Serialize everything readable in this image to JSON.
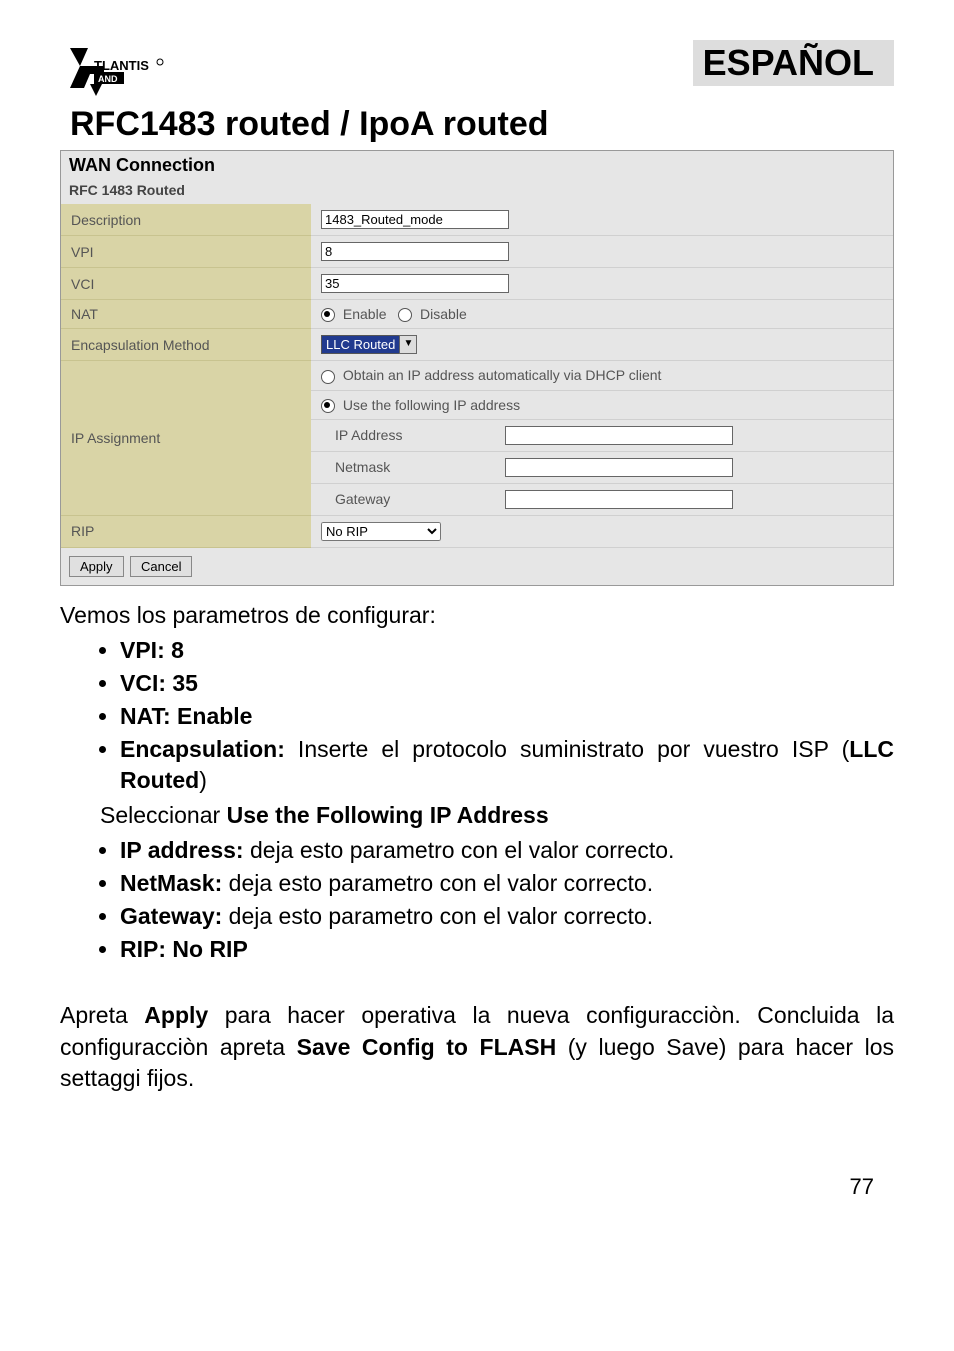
{
  "header": {
    "logo_text_top": "TLANTIS",
    "logo_text_bottom": "AND",
    "language": "ESPAÑOL"
  },
  "title": "RFC1483 routed / IpoA routed",
  "panel": {
    "section": "WAN Connection",
    "subsection": "RFC 1483 Routed",
    "rows": {
      "description": {
        "label": "Description",
        "value": "1483_Routed_mode"
      },
      "vpi": {
        "label": "VPI",
        "value": "8"
      },
      "vci": {
        "label": "VCI",
        "value": "35"
      },
      "nat": {
        "label": "NAT",
        "enable": "Enable",
        "disable": "Disable"
      },
      "encap": {
        "label": "Encapsulation Method",
        "value": "LLC Routed"
      },
      "ipassign": {
        "label": "IP Assignment",
        "opt_dhcp": "Obtain an IP address automatically via DHCP client",
        "opt_static": "Use the following IP address",
        "ip_label": "IP Address",
        "netmask_label": "Netmask",
        "gateway_label": "Gateway"
      },
      "rip": {
        "label": "RIP",
        "value": "No RIP"
      }
    },
    "buttons": {
      "apply": "Apply",
      "cancel": "Cancel"
    }
  },
  "body": {
    "intro": "Vemos los parametros de configurar:",
    "b1_label": "VPI: 8",
    "b2_label": "VCI: 35",
    "b3_label": "NAT: Enable",
    "b4_label": "Encapsulation:",
    "b4_text": " Inserte el protocolo  suministrato por vuestro ISP (",
    "b4_bold2": "LLC Routed",
    "b4_tail": ")",
    "select_line_pre": "Seleccionar ",
    "select_line_bold": "Use the Following IP Address",
    "b5_label": "IP address:",
    "b5_text": " deja esto parametro con el valor correcto.",
    "b6_label": "NetMask:",
    "b6_text": " deja esto parametro con el valor correcto.",
    "b7_label": "Gateway:",
    "b7_text": " deja esto parametro con el valor correcto.",
    "b8_label": "RIP: No RIP",
    "p2_pre": "Apreta ",
    "p2_b1": "Apply",
    "p2_mid": " para hacer operativa la nueva configuracciòn. Concluida la configuracciòn apreta ",
    "p2_b2": "Save Config to FLASH",
    "p2_tail": " (y luego Save) para hacer los settaggi fijos."
  },
  "page_number": "77"
}
